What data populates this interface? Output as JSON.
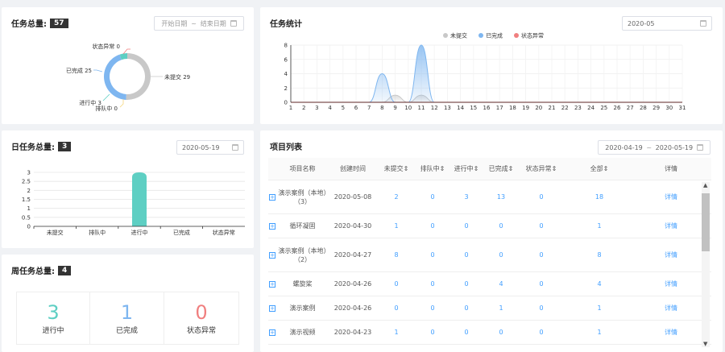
{
  "total_card": {
    "title": "任务总量:",
    "count": "57",
    "date_start_placeholder": "开始日期",
    "date_sep": "~",
    "date_end_placeholder": "结束日期",
    "donut": {
      "slices": [
        {
          "label": "未提交",
          "value": 29,
          "color": "#c8c8c8"
        },
        {
          "label": "已完成",
          "value": 25,
          "color": "#7eb6f0"
        },
        {
          "label": "进行中",
          "value": 3,
          "color": "#5ecfc3"
        },
        {
          "label": "排队中",
          "value": 0,
          "color": "#f5d67a"
        },
        {
          "label": "状态异常",
          "value": 0,
          "color": "#f07f7f"
        }
      ],
      "labels": {
        "status_error": "状态异常 0",
        "not_submitted": "未提交 29",
        "completed": "已完成 25",
        "in_progress": "进行中 3",
        "queued": "排队中 0"
      }
    }
  },
  "stats_card": {
    "title": "任务统计",
    "date": "2020-05",
    "legend": [
      {
        "label": "未提交",
        "color": "#c8c8c8"
      },
      {
        "label": "已完成",
        "color": "#7eb6f0"
      },
      {
        "label": "状态异常",
        "color": "#f07f7f"
      }
    ]
  },
  "daily_card": {
    "title": "日任务总量:",
    "count": "3",
    "date": "2020-05-19"
  },
  "weekly_card": {
    "title": "周任务总量:",
    "count": "4",
    "stats": [
      {
        "value": "3",
        "label": "进行中",
        "color": "#5ecfc3"
      },
      {
        "value": "1",
        "label": "已完成",
        "color": "#7eb6f0"
      },
      {
        "value": "0",
        "label": "状态异常",
        "color": "#f07f7f"
      }
    ]
  },
  "project_card": {
    "title": "项目列表",
    "date_start": "2020-04-19",
    "date_sep": "~",
    "date_end": "2020-05-19",
    "columns": [
      "项目名称",
      "创建时间",
      "未提交",
      "排队中",
      "进行中",
      "已完成",
      "状态异常",
      "全部",
      "详情"
    ],
    "rows": [
      {
        "name": "演示案例（本地）（3）",
        "created": "2020-05-08",
        "not_submitted": "2",
        "queued": "0",
        "in_progress": "3",
        "completed": "13",
        "error": "0",
        "total": "18",
        "detail": "详情"
      },
      {
        "name": "循环凝固",
        "created": "2020-04-30",
        "not_submitted": "1",
        "queued": "0",
        "in_progress": "0",
        "completed": "0",
        "error": "0",
        "total": "1",
        "detail": "详情"
      },
      {
        "name": "演示案例（本地）（2）",
        "created": "2020-04-27",
        "not_submitted": "8",
        "queued": "0",
        "in_progress": "0",
        "completed": "0",
        "error": "0",
        "total": "8",
        "detail": "详情"
      },
      {
        "name": "螺旋桨",
        "created": "2020-04-26",
        "not_submitted": "0",
        "queued": "0",
        "in_progress": "0",
        "completed": "4",
        "error": "0",
        "total": "4",
        "detail": "详情"
      },
      {
        "name": "演示案例",
        "created": "2020-04-26",
        "not_submitted": "0",
        "queued": "0",
        "in_progress": "0",
        "completed": "1",
        "error": "0",
        "total": "1",
        "detail": "详情"
      },
      {
        "name": "演示视频",
        "created": "2020-04-23",
        "not_submitted": "1",
        "queued": "0",
        "in_progress": "0",
        "completed": "0",
        "error": "0",
        "total": "1",
        "detail": "详情"
      }
    ]
  },
  "chart_data": [
    {
      "type": "area",
      "x": [
        1,
        2,
        3,
        4,
        5,
        6,
        7,
        8,
        9,
        10,
        11,
        12,
        13,
        14,
        15,
        16,
        17,
        18,
        19,
        20,
        21,
        22,
        23,
        24,
        25,
        26,
        27,
        28,
        29,
        30,
        31
      ],
      "series": [
        {
          "name": "未提交",
          "values": [
            0,
            0,
            0,
            0,
            0,
            0,
            0,
            0,
            1,
            0,
            1,
            0,
            0,
            0,
            0,
            0,
            0,
            0,
            0,
            0,
            0,
            0,
            0,
            0,
            0,
            0,
            0,
            0,
            0,
            0,
            0
          ]
        },
        {
          "name": "已完成",
          "values": [
            0,
            0,
            0,
            0,
            0,
            0,
            0,
            4,
            0,
            0,
            8,
            0,
            0,
            0,
            0,
            0,
            0,
            0,
            0,
            0,
            0,
            0,
            0,
            0,
            0,
            0,
            0,
            0,
            0,
            0,
            0
          ]
        },
        {
          "name": "状态异常",
          "values": [
            0,
            0,
            0,
            0,
            0,
            0,
            0,
            0,
            0,
            0,
            0,
            0,
            0,
            0,
            0,
            0,
            0,
            0,
            0,
            0,
            0,
            0,
            0,
            0,
            0,
            0,
            0,
            0,
            0,
            0,
            0
          ]
        }
      ],
      "ylim": [
        0,
        8
      ],
      "yticks": [
        0,
        2,
        4,
        6,
        8
      ]
    },
    {
      "type": "bar",
      "categories": [
        "未提交",
        "排队中",
        "进行中",
        "已完成",
        "状态异常"
      ],
      "values": [
        0,
        0,
        3,
        0,
        0
      ],
      "ylim": [
        0,
        3
      ],
      "yticks": [
        "0",
        "0.5",
        "1",
        "1.5",
        "2",
        "2.5",
        "3"
      ],
      "color": "#5ecfc3"
    }
  ]
}
